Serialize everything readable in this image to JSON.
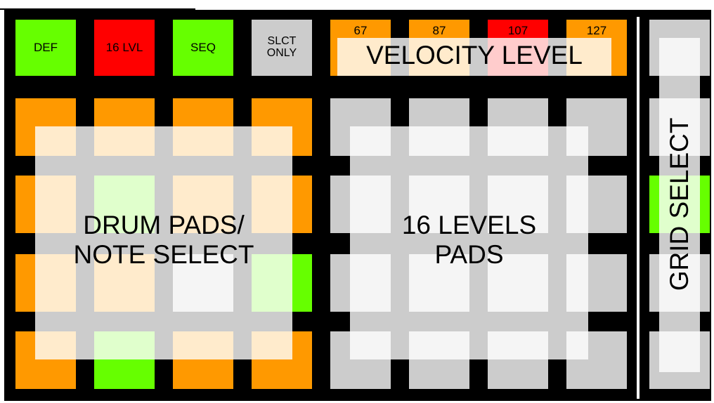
{
  "colors": {
    "orange": "#FF9900",
    "red": "#FF0000",
    "green": "#66FF00",
    "grey": "#CCCCCC",
    "black": "#000000",
    "overlay": "#FFFFFF"
  },
  "modes": [
    {
      "label": "DEF",
      "color": "green"
    },
    {
      "label": "16 LVL",
      "color": "red"
    },
    {
      "label": "SEQ",
      "color": "green"
    },
    {
      "label": "SLCT\nONLY",
      "color": "grey"
    }
  ],
  "velocity": {
    "title": "VELOCITY LEVEL",
    "levels": [
      {
        "value": "67",
        "color": "orange"
      },
      {
        "value": "87",
        "color": "orange"
      },
      {
        "value": "107",
        "color": "red"
      },
      {
        "value": "127",
        "color": "orange"
      }
    ]
  },
  "drum_pads": {
    "title": "DRUM PADS/\nNOTE SELECT",
    "rows": [
      [
        "orange",
        "orange",
        "orange",
        "orange"
      ],
      [
        "orange",
        "green",
        "orange",
        "orange"
      ],
      [
        "orange",
        "orange",
        "grey",
        "green"
      ],
      [
        "orange",
        "green",
        "orange",
        "orange"
      ]
    ]
  },
  "level_pads": {
    "title": "16 LEVELS\nPADS",
    "rows": [
      [
        "grey",
        "grey",
        "grey",
        "grey"
      ],
      [
        "grey",
        "grey",
        "grey",
        "grey"
      ],
      [
        "grey",
        "grey",
        "grey",
        "grey"
      ],
      [
        "grey",
        "grey",
        "grey",
        "grey"
      ]
    ]
  },
  "grid_select": {
    "title": "GRID SELECT",
    "cells": [
      "grey",
      "grey",
      "green",
      "grey",
      "grey"
    ]
  }
}
